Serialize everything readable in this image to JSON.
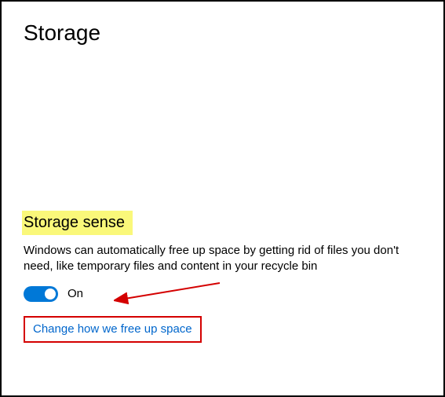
{
  "page": {
    "title": "Storage"
  },
  "section": {
    "heading": "Storage sense",
    "description": "Windows can automatically free up space by getting rid of files you don't need, like temporary files and content in your recycle bin"
  },
  "toggle": {
    "state_label": "On",
    "enabled": true
  },
  "link": {
    "label": "Change how we free up space"
  },
  "annotation": {
    "highlight_color": "#faf87a",
    "box_color": "#d40000",
    "arrow_color": "#d40000"
  }
}
